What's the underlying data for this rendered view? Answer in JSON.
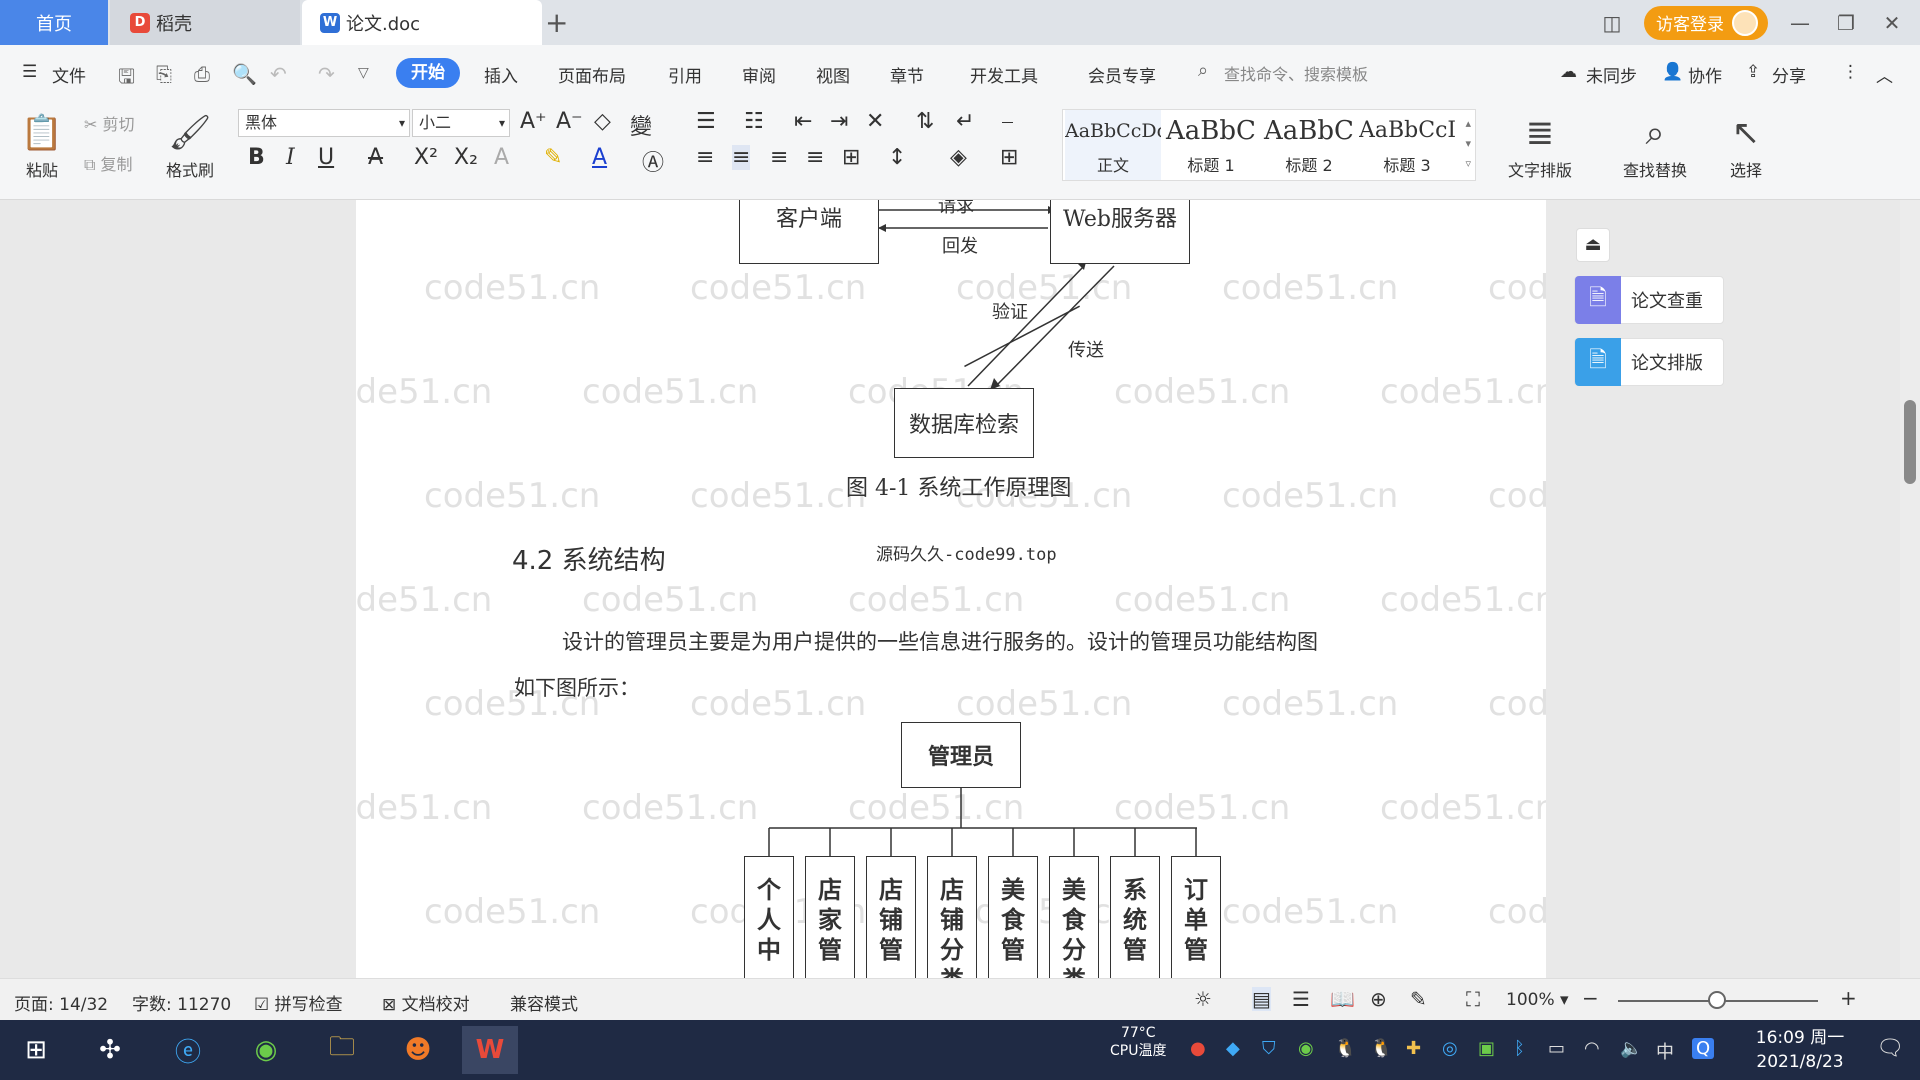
{
  "tabs": {
    "home": "首页",
    "daoke": "稻壳",
    "doc": "论文.doc"
  },
  "top_right": {
    "login": "访客登录"
  },
  "menu": {
    "file": "文件",
    "items": [
      "开始",
      "插入",
      "页面布局",
      "引用",
      "审阅",
      "视图",
      "章节",
      "开发工具",
      "会员专享"
    ],
    "search_placeholder": "查找命令、搜索模板",
    "sync": "未同步",
    "collab": "协作",
    "share": "分享"
  },
  "ribbon": {
    "paste": "粘贴",
    "cut": "剪切",
    "copy": "复制",
    "format_painter": "格式刷",
    "font_name": "黑体",
    "font_size": "小二",
    "styles": [
      {
        "sample": "AaBbCcDd",
        "name": "正文"
      },
      {
        "sample": "AaBbC",
        "name": "标题 1"
      },
      {
        "sample": "AaBbC",
        "name": "标题 2"
      },
      {
        "sample": "AaBbCcI",
        "name": "标题 3"
      }
    ],
    "text_layout": "文字排版",
    "find_replace": "查找替换",
    "select": "选择"
  },
  "document": {
    "fig1": {
      "client": "客户端",
      "request": "请求",
      "reply": "回发",
      "web_server": "Web服务器",
      "verify": "验证",
      "send": "传送",
      "db": "数据库检索",
      "caption": "图 4-1 系统工作原理图"
    },
    "section_heading": "4.2 系统结构",
    "source_note": "源码久久-code99.top",
    "paragraph_line1": "设计的管理员主要是为用户提供的一些信息进行服务的。设计的管理员功能结构图",
    "paragraph_line2": "如下图所示：",
    "fig2": {
      "root": "管理员",
      "children": [
        "个人中",
        "店家管",
        "店铺管",
        "店铺分类",
        "美食管",
        "美食分类",
        "系统管",
        "订单管"
      ]
    },
    "watermark": "code51.cn"
  },
  "right_panel": {
    "check": "论文查重",
    "layout": "论文排版"
  },
  "status": {
    "page": "页面: 14/32",
    "words": "字数: 11270",
    "spell": "拼写检查",
    "proof": "文档校对",
    "compat": "兼容模式",
    "zoom": "100%",
    "zoom_level": 0.5
  },
  "taskbar": {
    "cpu_temp": "77°C",
    "cpu_label": "CPU温度",
    "ime": "中",
    "time": "16:09 周一",
    "date": "2021/8/23"
  },
  "colors": {
    "accent": "#3a7ff0",
    "login": "#f39c12",
    "taskbar": "#1f2a44"
  }
}
